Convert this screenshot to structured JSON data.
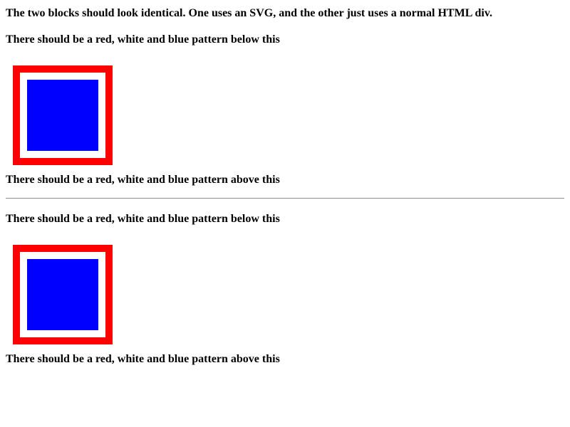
{
  "intro": "The two blocks should look identical. One uses an SVG, and the other just uses a normal HTML div.",
  "blocks": [
    {
      "kind": "svg",
      "label_above": "There should be a red, white and blue pattern below this",
      "label_below": "There should be a red, white and blue pattern above this"
    },
    {
      "kind": "div",
      "label_above": "There should be a red, white and blue pattern below this",
      "label_below": "There should be a red, white and blue pattern above this"
    }
  ],
  "colors": {
    "outer_ring": "#ff0000",
    "gap": "#ffffff",
    "inner_square": "#0000ff",
    "divider": "#9a9a9a"
  }
}
